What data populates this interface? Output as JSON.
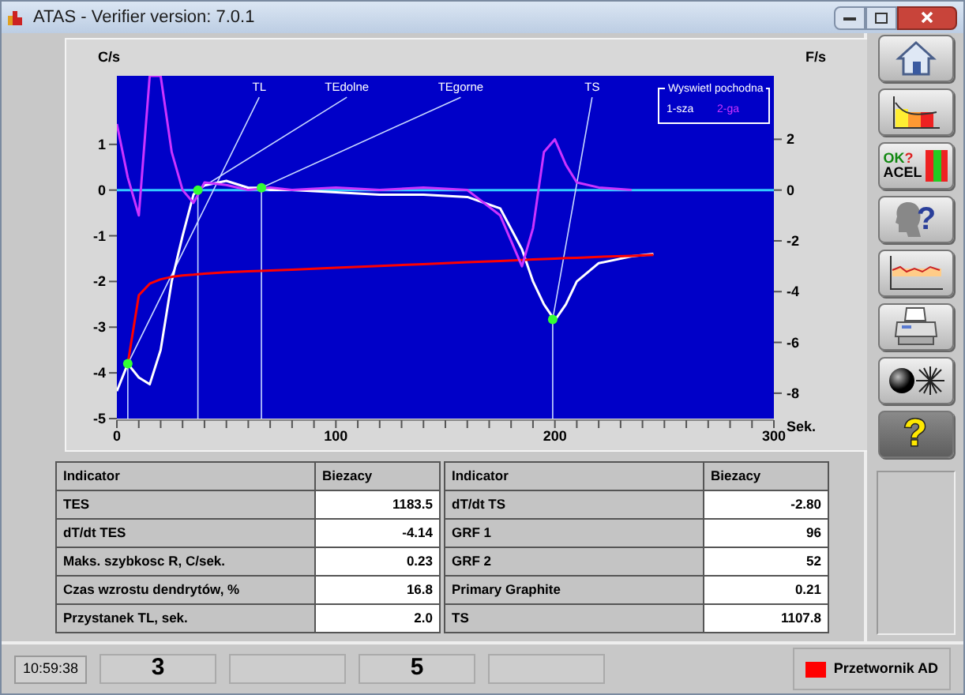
{
  "window": {
    "title": "ATAS - Verifier version: 7.0.1"
  },
  "chart": {
    "chart_data": {
      "type": "line",
      "ylabel": "C/s",
      "y2label": "F/s",
      "xlabel": "Sek.",
      "xlim": [
        0,
        300
      ],
      "ylim": [
        -5,
        2.5
      ],
      "y2lim": [
        -9,
        4.5
      ],
      "xticks": [
        0,
        100,
        200,
        300
      ],
      "yticks": [
        1,
        0,
        -1,
        -2,
        -3,
        -4,
        -5
      ],
      "y2ticks": [
        2,
        0,
        -2,
        -4,
        -6,
        -8
      ],
      "x": [
        0,
        5,
        10,
        15,
        20,
        25,
        30,
        35,
        37,
        40,
        50,
        60,
        66,
        70,
        80,
        100,
        120,
        140,
        160,
        175,
        185,
        190,
        195,
        200,
        205,
        210,
        220,
        235,
        245
      ],
      "series": [
        {
          "name": "1-sza",
          "color": "#ffffff",
          "values": [
            -4.4,
            -3.8,
            -4.1,
            -4.25,
            -3.5,
            -2.0,
            -1.0,
            -0.1,
            0,
            0.1,
            0.2,
            0.05,
            0.05,
            0.0,
            0.0,
            -0.05,
            -0.1,
            -0.1,
            -0.15,
            -0.4,
            -1.3,
            -2.0,
            -2.5,
            -2.85,
            -2.5,
            -2.0,
            -1.6,
            -1.45,
            -1.4
          ]
        },
        {
          "color": "#ff0000",
          "values": [
            null,
            -3.8,
            -2.3,
            -2.05,
            -1.95,
            -1.9,
            -1.87,
            -1.85,
            -1.84,
            -1.83,
            -1.8,
            -1.78,
            -1.77,
            -1.76,
            -1.74,
            -1.7,
            -1.66,
            -1.62,
            -1.58,
            -1.55,
            -1.53,
            -1.52,
            -1.51,
            -1.5,
            -1.49,
            -1.48,
            -1.46,
            -1.44,
            -1.42
          ]
        },
        {
          "name": "2-ga",
          "color": "#cc33ff",
          "axis": "y2",
          "values": [
            2.6,
            0.5,
            -1.0,
            4.5,
            4.5,
            1.5,
            0,
            -0.5,
            -0.2,
            0.3,
            0.2,
            0,
            0.05,
            0.1,
            0,
            0.1,
            0,
            0.1,
            0,
            -1,
            -3,
            -1.5,
            1.5,
            2,
            1,
            0.3,
            0.1,
            0,
            null
          ]
        }
      ],
      "annotations": [
        "TL",
        "TEdolne",
        "TEgorne",
        "TS"
      ],
      "ref_lines": [
        {
          "axis": "y",
          "value": 0,
          "color": "#33ccff"
        }
      ]
    },
    "legend": {
      "title": "Wyswietl pochodna"
    }
  },
  "tables": [
    {
      "columns": [
        "Indicator",
        "Biezacy"
      ],
      "rows": [
        [
          "TES",
          "1183.5"
        ],
        [
          "dT/dt TES",
          "-4.14"
        ],
        [
          "Maks. szybkosc R, C/sek.",
          "0.23"
        ],
        [
          "Czas wzrostu dendrytów, %",
          "16.8"
        ],
        [
          "Przystanek TL, sek.",
          "2.0"
        ]
      ]
    },
    {
      "columns": [
        "Indicator",
        "Biezacy"
      ],
      "rows": [
        [
          "dT/dt TS",
          "-2.80"
        ],
        [
          "GRF 1",
          "96"
        ],
        [
          "GRF 2",
          "52"
        ],
        [
          "Primary Graphite",
          "0.21"
        ],
        [
          "TS",
          "1107.8"
        ]
      ]
    }
  ],
  "toolbar": [
    {
      "kind": "home"
    },
    {
      "kind": "histogram"
    },
    {
      "kind": "ok-acel",
      "ok": "OK",
      "mark": "?",
      "label": "ACEL"
    },
    {
      "kind": "head-help",
      "mark": "?"
    },
    {
      "kind": "curve-chart"
    },
    {
      "kind": "printer"
    },
    {
      "kind": "ball-burst"
    },
    {
      "kind": "help",
      "mark": "?"
    }
  ],
  "status_bar": {
    "time": "10:59:38",
    "slots": [
      {
        "kind": "text",
        "value": "3"
      },
      {
        "kind": "empty"
      },
      {
        "kind": "text",
        "value": "5"
      },
      {
        "kind": "empty"
      }
    ],
    "indicator": {
      "label": "Przetwornik AD",
      "color": "#ff0000"
    }
  }
}
